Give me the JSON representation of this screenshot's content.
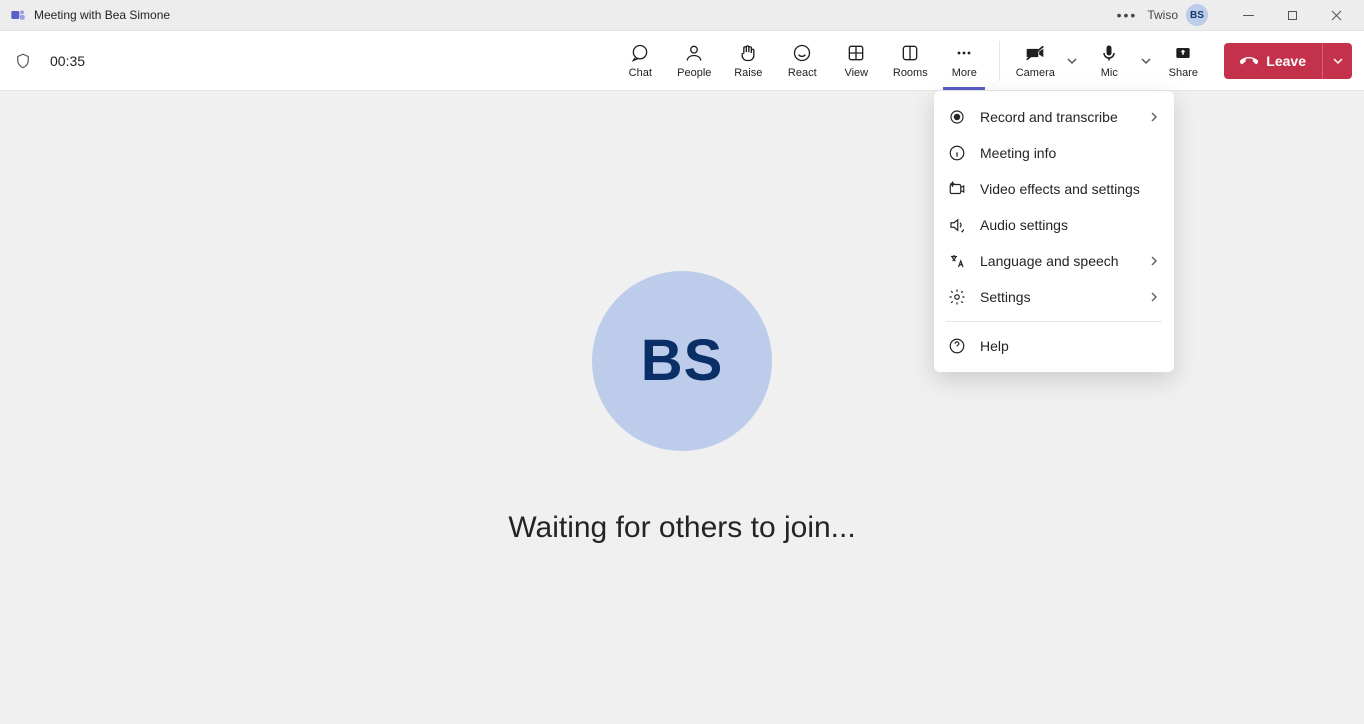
{
  "titlebar": {
    "title": "Meeting with Bea Simone",
    "tenant": "Twiso",
    "avatar_initials": "BS"
  },
  "toolbar": {
    "timer": "00:35",
    "buttons": {
      "chat": "Chat",
      "people": "People",
      "raise": "Raise",
      "react": "React",
      "view": "View",
      "rooms": "Rooms",
      "more": "More",
      "camera": "Camera",
      "mic": "Mic",
      "share": "Share"
    },
    "leave": "Leave"
  },
  "more_menu": {
    "record": "Record and transcribe",
    "info": "Meeting info",
    "video": "Video effects and settings",
    "audio": "Audio settings",
    "language": "Language and speech",
    "settings": "Settings",
    "help": "Help"
  },
  "stage": {
    "avatar_initials": "BS",
    "waiting": "Waiting for others to join..."
  }
}
